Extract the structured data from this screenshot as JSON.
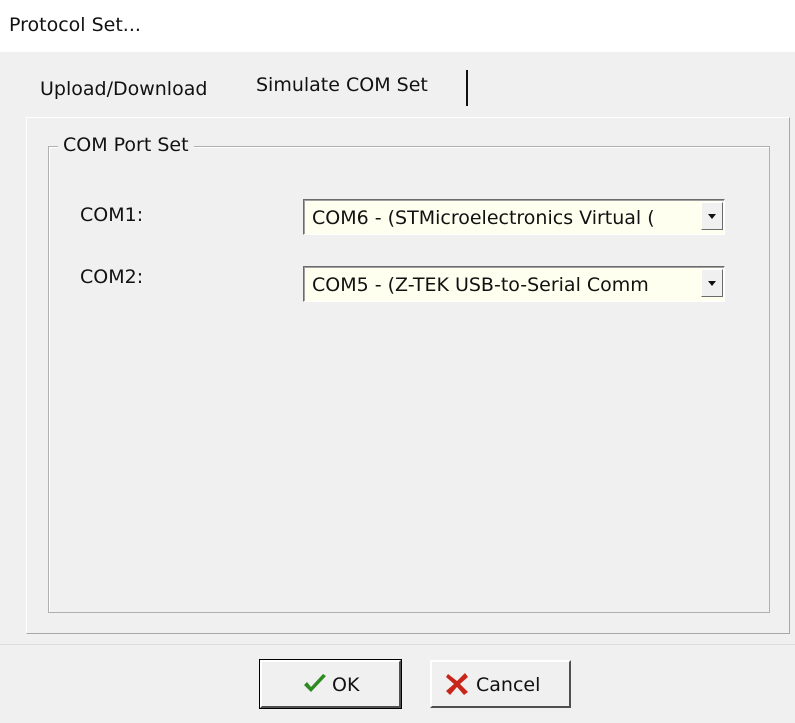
{
  "window": {
    "title": "Protocol Set..."
  },
  "tabs": [
    {
      "label": "Upload/Download",
      "selected": false
    },
    {
      "label": "Simulate COM Set",
      "selected": true
    }
  ],
  "group": {
    "legend": "COM Port Set",
    "fields": [
      {
        "label": "COM1:",
        "value": "COM6 - (STMicroelectronics Virtual ("
      },
      {
        "label": "COM2:",
        "value": "COM5 - (Z-TEK USB-to-Serial Comm"
      }
    ]
  },
  "buttons": {
    "ok_label": "OK",
    "ok_icon": "checkmark-icon",
    "cancel_label": "Cancel",
    "cancel_icon": "x-mark-icon"
  },
  "colors": {
    "ok_icon": "#2e8b22",
    "cancel_icon": "#c8261b",
    "combo_background": "#fffff0"
  }
}
